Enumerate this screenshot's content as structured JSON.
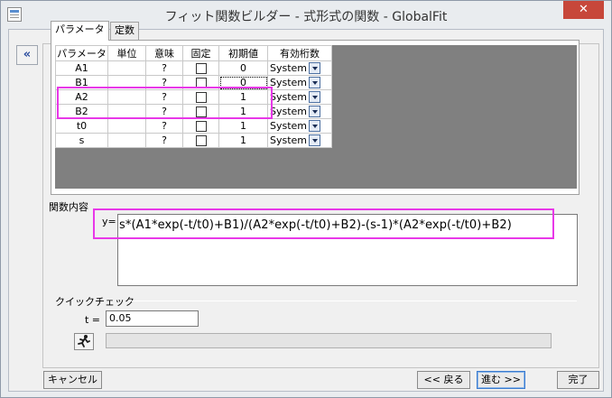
{
  "window": {
    "title": "フィット関数ビルダー - 式形式の関数 - GlobalFit",
    "close_label": "✕"
  },
  "nav": {
    "collapse_label": "«"
  },
  "tabs": [
    {
      "label": "パラメータ",
      "active": true
    },
    {
      "label": "定数",
      "active": false
    }
  ],
  "param_table": {
    "headers": [
      "パラメータ",
      "単位",
      "意味",
      "固定",
      "初期値",
      "有効桁数"
    ],
    "rows": [
      {
        "name": "A1",
        "unit": "",
        "meaning": "?",
        "fixed": false,
        "initial": "0",
        "sig": "System"
      },
      {
        "name": "B1",
        "unit": "",
        "meaning": "?",
        "fixed": false,
        "initial": "0",
        "sig": "System"
      },
      {
        "name": "A2",
        "unit": "",
        "meaning": "?",
        "fixed": false,
        "initial": "1",
        "sig": "System"
      },
      {
        "name": "B2",
        "unit": "",
        "meaning": "?",
        "fixed": false,
        "initial": "1",
        "sig": "System"
      },
      {
        "name": "t0",
        "unit": "",
        "meaning": "?",
        "fixed": false,
        "initial": "1",
        "sig": "System"
      },
      {
        "name": "s",
        "unit": "",
        "meaning": "?",
        "fixed": false,
        "initial": "1",
        "sig": "System"
      }
    ]
  },
  "function_body": {
    "section_label": "関数内容",
    "y_label": "y=",
    "expression": "s*(A1*exp(-t/t0)+B1)/(A2*exp(-t/t0)+B2)-(s-1)*(A2*exp(-t/t0)+B2)"
  },
  "quick_check": {
    "label": "クイックチェック",
    "t_label": "t =",
    "t_value": "0.05",
    "result": ""
  },
  "buttons": {
    "cancel": "キャンセル",
    "back": "<< 戻る",
    "next": "進む >>",
    "finish": "完了"
  },
  "colors": {
    "highlight": "#e838e8",
    "window_bg": "#e9ecef",
    "close_red": "#c7473a"
  }
}
